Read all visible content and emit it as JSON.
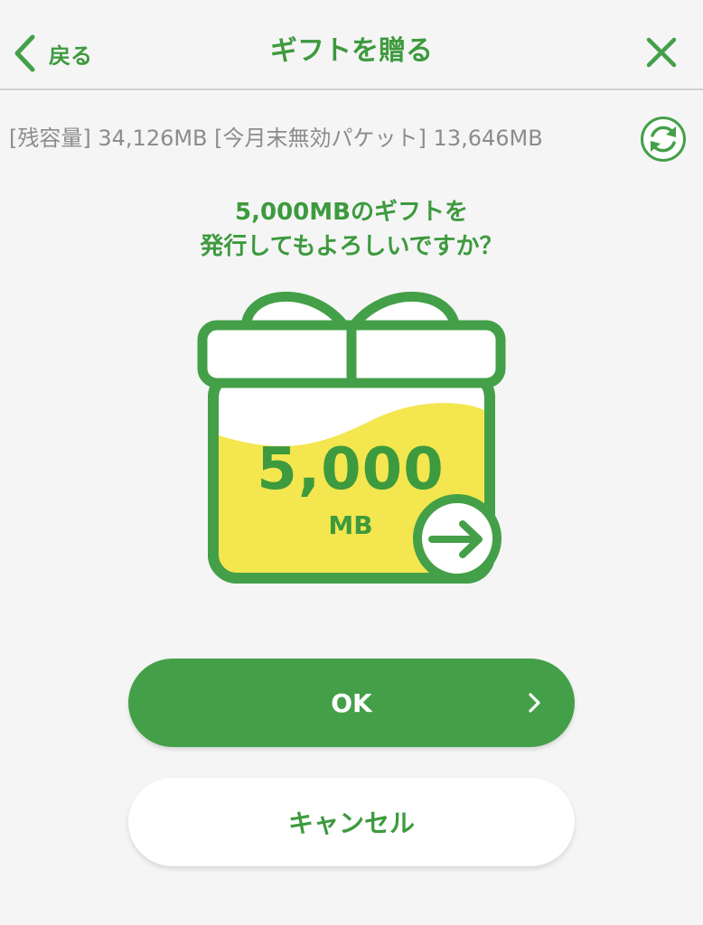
{
  "header": {
    "back_label": "戻る",
    "title": "ギフトを贈る"
  },
  "info": {
    "remaining_label": "[残容量]",
    "remaining_value": "34,126MB",
    "expiring_label": "[今月末無効パケット]",
    "expiring_value": "13,646MB"
  },
  "question": {
    "line1": "5,000MBのギフトを",
    "line2": "発行してもよろしいですか？"
  },
  "gift": {
    "amount": "5,000",
    "unit": "MB"
  },
  "buttons": {
    "ok_label": "OK",
    "cancel_label": "キャンセル"
  },
  "colors": {
    "brand_green": "#44a048",
    "text_green": "#3d9a3e",
    "gift_yellow": "#f3e64f",
    "background": "#f5f5f5",
    "info_gray": "#8c8c8c"
  },
  "icons": {
    "back": "chevron-left-icon",
    "close": "close-icon",
    "refresh": "refresh-icon",
    "gift": "gift-box-icon",
    "send": "arrow-right-icon",
    "ok_chevron": "chevron-right-icon"
  }
}
